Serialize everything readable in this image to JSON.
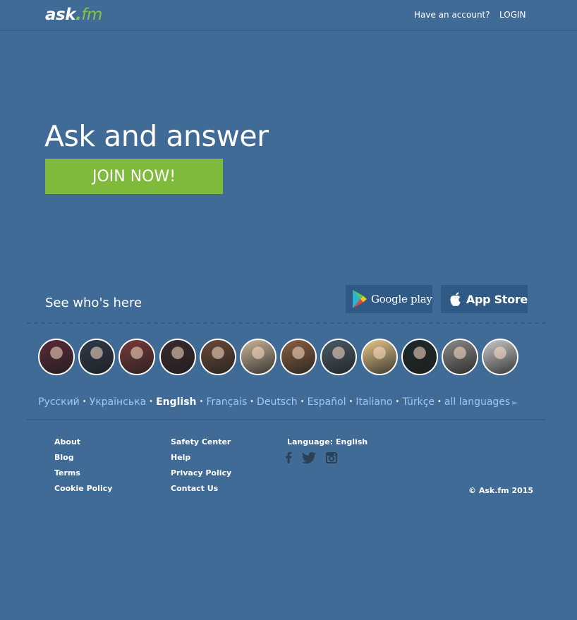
{
  "header": {
    "logo": {
      "part1": "ask",
      "part2": ".",
      "part3": "fm"
    },
    "have_account": "Have an account?",
    "login": "LOGIN"
  },
  "hero": {
    "title": "Ask and answer",
    "join_button": "JOIN NOW!"
  },
  "see_who": {
    "label": "See who's here",
    "google_play": {
      "label": "Google play",
      "icon": "google-play-icon"
    },
    "app_store": {
      "label": "App Store",
      "icon": "apple-icon"
    }
  },
  "avatars": [
    {
      "icon": "user-avatar",
      "color": "#5a2a3a"
    },
    {
      "icon": "user-avatar",
      "color": "#2e3a4e"
    },
    {
      "icon": "user-avatar",
      "color": "#7a3a3a"
    },
    {
      "icon": "user-avatar",
      "color": "#3a2a30"
    },
    {
      "icon": "user-avatar",
      "color": "#6b4a3a"
    },
    {
      "icon": "user-avatar",
      "color": "#c9b49a"
    },
    {
      "icon": "user-avatar",
      "color": "#8a6040"
    },
    {
      "icon": "user-avatar",
      "color": "#4a5a6a"
    },
    {
      "icon": "user-avatar",
      "color": "#e6c88a"
    },
    {
      "icon": "user-avatar",
      "color": "#1e2a2a"
    },
    {
      "icon": "user-avatar",
      "color": "#8a8a8a"
    },
    {
      "icon": "user-avatar",
      "color": "#c8c8c8"
    }
  ],
  "languages": {
    "items": [
      "Русский",
      "Українська",
      "English",
      "Français",
      "Deutsch",
      "Español",
      "Italiano",
      "Türkçe",
      "all languages"
    ],
    "current": "English",
    "separator": "•",
    "arrow": "►"
  },
  "footer": {
    "col1": [
      "About",
      "Blog",
      "Terms",
      "Cookie Policy"
    ],
    "col2": [
      "Safety Center",
      "Help",
      "Privacy Policy",
      "Contact Us"
    ],
    "language_label": "Language:",
    "language_value": "English",
    "socials": [
      "facebook-icon",
      "twitter-icon",
      "instagram-icon"
    ],
    "copyright": "© Ask.fm 2015"
  },
  "colors": {
    "background": "#416b97",
    "accent_green": "#7fba3a",
    "store_button": "#2f5a85",
    "link_light": "#9dc6f0",
    "social_icon": "#2b3f55"
  }
}
